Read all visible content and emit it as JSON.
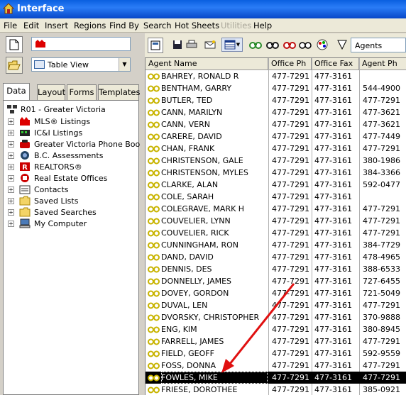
{
  "window": {
    "title": "Interface"
  },
  "menu": [
    "File",
    "Edit",
    "Insert",
    "Regions",
    "Find By",
    "Search",
    "Hot Sheets",
    "Utilities",
    "Help"
  ],
  "menu_disabled": [
    "Utilities"
  ],
  "left": {
    "view_combo": {
      "value": "Table View",
      "icon": "table-icon"
    },
    "tabs": [
      "Data",
      "Layout",
      "Forms",
      "Templates"
    ],
    "active_tab": "Data",
    "tree": {
      "root": "R01 - Greater Victoria",
      "items": [
        {
          "label": "MLS® Listings",
          "icon": "mls-icon"
        },
        {
          "label": "IC&I Listings",
          "icon": "ici-icon"
        },
        {
          "label": "Greater Victoria Phone Book",
          "icon": "phone-icon"
        },
        {
          "label": "B.C. Assessments",
          "icon": "assessment-icon"
        },
        {
          "label": "REALTORS®",
          "icon": "realtor-icon"
        },
        {
          "label": "Real Estate Offices",
          "icon": "office-icon"
        },
        {
          "label": "Contacts",
          "icon": "contacts-icon"
        },
        {
          "label": "Saved Lists",
          "icon": "folder-icon"
        },
        {
          "label": "Saved Searches",
          "icon": "folder-icon"
        },
        {
          "label": "My Computer",
          "icon": "computer-icon"
        }
      ]
    }
  },
  "right": {
    "agents_combo": "Agents",
    "columns": [
      "Agent Name",
      "Office Ph",
      "Office Fax",
      "Agent Ph"
    ],
    "selected_row": "FOWLES, MIKE",
    "rows": [
      [
        "BAHREY, RONALD R",
        "477-7291",
        "477-3161",
        ""
      ],
      [
        "BENTHAM, GARRY",
        "477-7291",
        "477-3161",
        "544-4900"
      ],
      [
        "BUTLER, TED",
        "477-7291",
        "477-3161",
        "477-7291"
      ],
      [
        "CANN, MARILYN",
        "477-7291",
        "477-3161",
        "477-3621"
      ],
      [
        "CANN, VERN",
        "477-7291",
        "477-3161",
        "477-3621"
      ],
      [
        "CARERE, DAVID",
        "477-7291",
        "477-3161",
        "477-7449"
      ],
      [
        "CHAN, FRANK",
        "477-7291",
        "477-3161",
        "477-7291"
      ],
      [
        "CHRISTENSON, GALE",
        "477-7291",
        "477-3161",
        "380-1986"
      ],
      [
        "CHRISTENSON, MYLES",
        "477-7291",
        "477-3161",
        "384-3366"
      ],
      [
        "CLARKE, ALAN",
        "477-7291",
        "477-3161",
        "592-0477"
      ],
      [
        "COLE, SARAH",
        "477-7291",
        "477-3161",
        ""
      ],
      [
        "COLEGRAVE, MARK H",
        "477-7291",
        "477-3161",
        "477-7291"
      ],
      [
        "COUVELIER, LYNN",
        "477-7291",
        "477-3161",
        "477-7291"
      ],
      [
        "COUVELIER, RICK",
        "477-7291",
        "477-3161",
        "477-7291"
      ],
      [
        "CUNNINGHAM, RON",
        "477-7291",
        "477-3161",
        "384-7729"
      ],
      [
        "DAND, DAVID",
        "477-7291",
        "477-3161",
        "478-4965"
      ],
      [
        "DENNIS, DES",
        "477-7291",
        "477-3161",
        "388-6533"
      ],
      [
        "DONNELLY, JAMES",
        "477-7291",
        "477-3161",
        "727-6455"
      ],
      [
        "DOVEY, GORDON",
        "477-7291",
        "477-3161",
        "721-5049"
      ],
      [
        "DUVAL, LEN",
        "477-7291",
        "477-3161",
        "477-7291"
      ],
      [
        "DVORSKY, CHRISTOPHER",
        "477-7291",
        "477-3161",
        "370-9888"
      ],
      [
        "ENG, KIM",
        "477-7291",
        "477-3161",
        "380-8945"
      ],
      [
        "FARRELL, JAMES",
        "477-7291",
        "477-3161",
        "477-7291"
      ],
      [
        "FIELD, GEOFF",
        "477-7291",
        "477-3161",
        "592-9559"
      ],
      [
        "FOSS, DONNA",
        "477-7291",
        "477-3161",
        "477-7291"
      ],
      [
        "FOWLES, MIKE",
        "477-7291",
        "477-3161",
        "477-7291"
      ],
      [
        "FRIESE, DOROTHEE",
        "477-7291",
        "477-3161",
        "385-0921"
      ]
    ]
  },
  "colors": {
    "titlebar": "#0a5fe0",
    "selection": "#000000",
    "arrow": "#e01010",
    "glasses": "#c8b400"
  }
}
